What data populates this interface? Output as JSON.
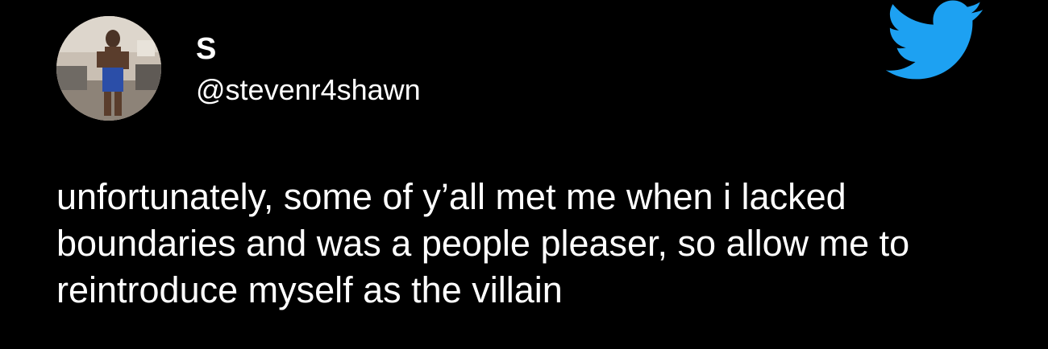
{
  "user": {
    "display_name": "S",
    "handle": "@stevenr4shawn",
    "avatar_icon": "profile-photo"
  },
  "tweet": {
    "text": "unfortunately, some of y’all met me when i lacked boundaries and was a people pleaser, so allow me to reintroduce myself as the villain"
  },
  "brand": {
    "logo_icon": "twitter-bird-icon",
    "logo_color": "#1da1f2",
    "background": "#000000",
    "text_color": "#ffffff"
  }
}
